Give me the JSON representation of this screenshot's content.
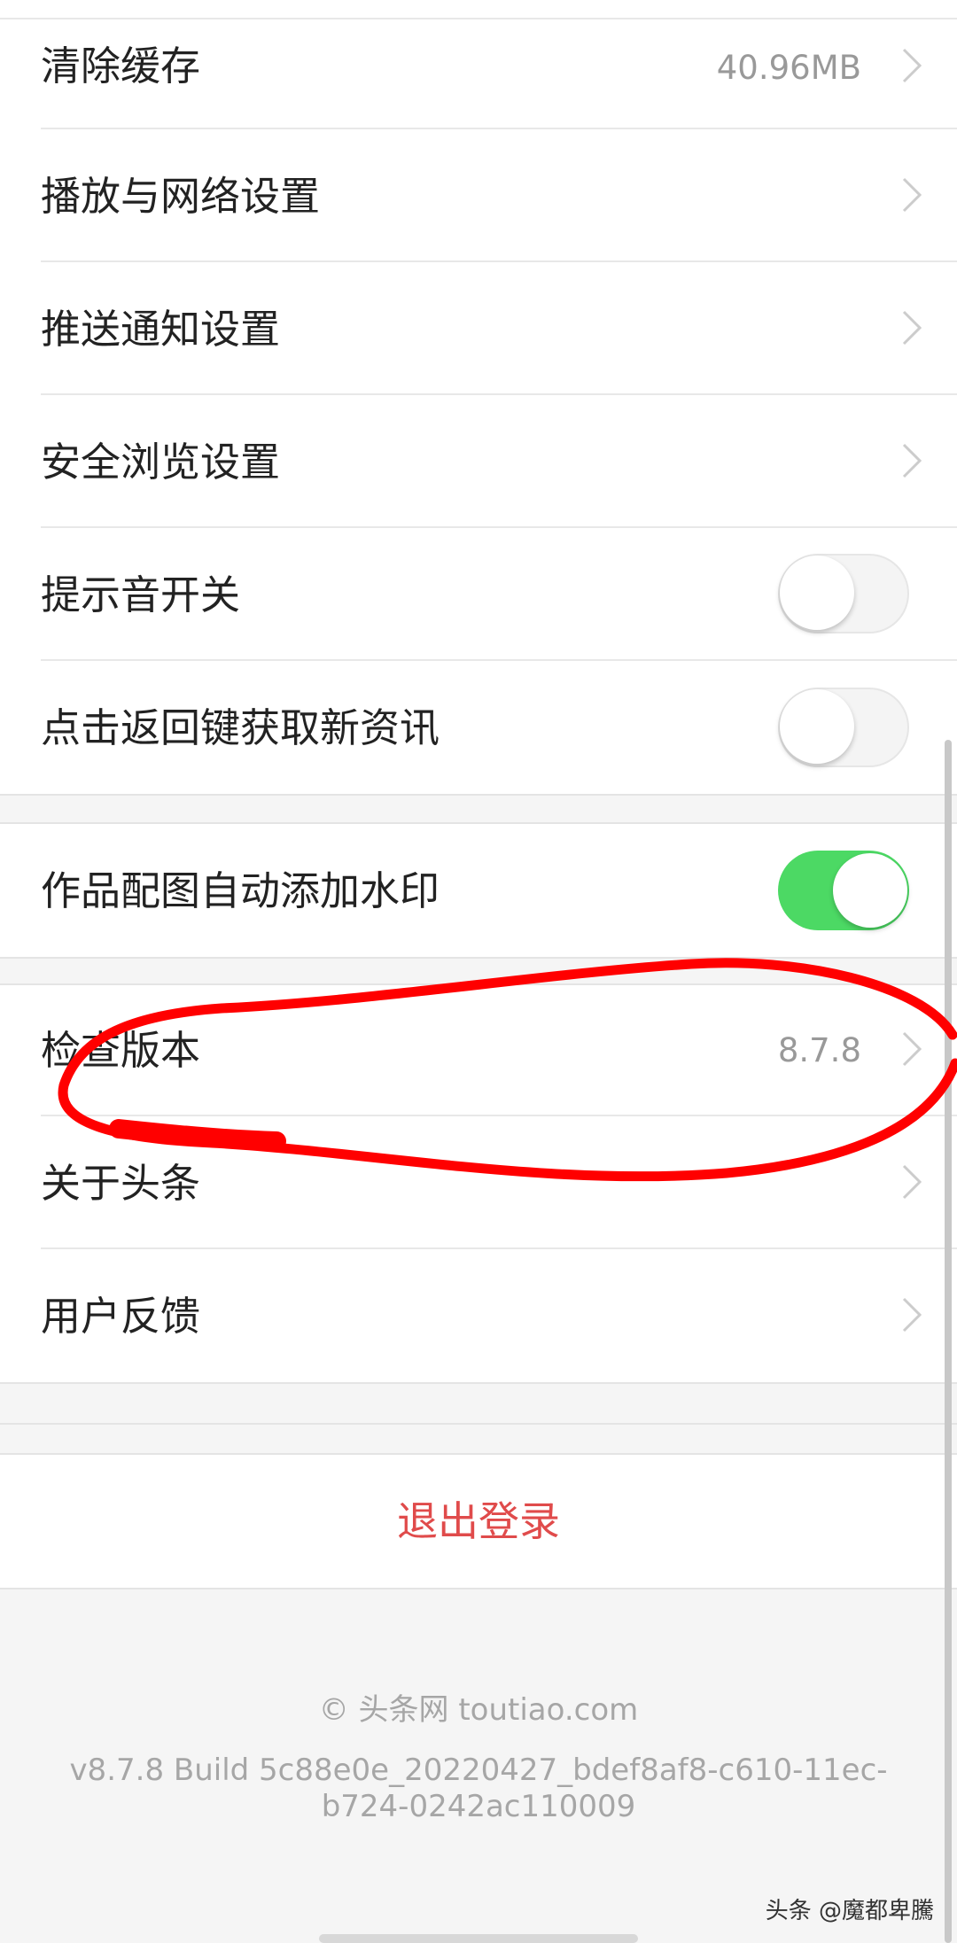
{
  "settings": {
    "clear_cache": {
      "label": "清除缓存",
      "value": "40.96MB"
    },
    "playback_network": {
      "label": "播放与网络设置"
    },
    "push_notifications": {
      "label": "推送通知设置"
    },
    "safe_browsing": {
      "label": "安全浏览设置"
    },
    "sound_toggle": {
      "label": "提示音开关",
      "on": false
    },
    "back_refresh": {
      "label": "点击返回键获取新资讯",
      "on": false
    }
  },
  "watermark_section": {
    "auto_watermark": {
      "label": "作品配图自动添加水印",
      "on": true
    }
  },
  "about_section": {
    "check_version": {
      "label": "检查版本",
      "value": "8.7.8"
    },
    "about_toutiao": {
      "label": "关于头条"
    },
    "feedback": {
      "label": "用户反馈"
    }
  },
  "logout_label": "退出登录",
  "footer": {
    "copyright": "© 头条网 toutiao.com",
    "build": "v8.7.8 Build 5c88e0e_20220427_bdef8af8-c610-11ec-b724-0242ac110009"
  },
  "image_watermark": "头条 @魔都卑騰",
  "colors": {
    "toggle_on": "#4cd964",
    "logout_red": "#e04b4b",
    "annotation_red": "#ff0000"
  }
}
